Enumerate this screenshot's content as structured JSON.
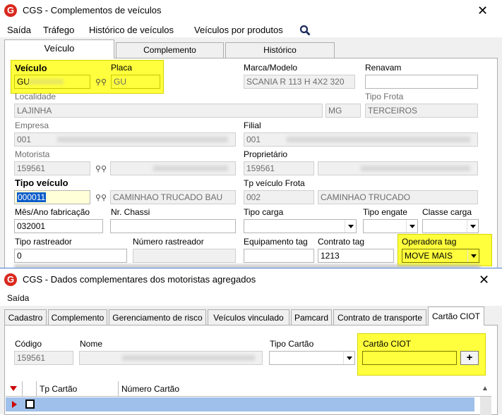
{
  "win1": {
    "title": "CGS - Complementos de veículos",
    "menu": [
      "Saída",
      "Tráfego",
      "Histórico de veículos",
      "Veículos por produtos"
    ],
    "tabs": [
      "Veículo",
      "Complemento",
      "Histórico"
    ],
    "fields": {
      "veiculo": {
        "label": "Veículo",
        "value": "GU"
      },
      "placa": {
        "label": "Placa",
        "value": "GU"
      },
      "marca": {
        "label": "Marca/Modelo",
        "value": "SCANIA R 113 H 4X2 320"
      },
      "renavam": {
        "label": "Renavam",
        "value": ""
      },
      "localidade": {
        "label": "Localidade",
        "value": "LAJINHA",
        "uf": "MG"
      },
      "tipo_frota": {
        "label": "Tipo Frota",
        "value": "TERCEIROS"
      },
      "empresa": {
        "label": "Empresa",
        "value": "001"
      },
      "filial": {
        "label": "Filial",
        "value": "001"
      },
      "motorista": {
        "label": "Motorista",
        "value": "159561"
      },
      "proprietario": {
        "label": "Proprietário",
        "value": "159561"
      },
      "tipo_veiculo": {
        "label": "Tipo veículo",
        "value": "000011",
        "desc": "CAMINHAO TRUCADO BAU"
      },
      "tp_veiculo_frota": {
        "label": "Tp veículo Frota",
        "value": "002",
        "desc": "CAMINHAO TRUCADO"
      },
      "mes_ano": {
        "label": "Mês/Ano fabricação",
        "value": "032001"
      },
      "nr_chassi": {
        "label": "Nr. Chassi",
        "value": ""
      },
      "tipo_carga": {
        "label": "Tipo carga",
        "value": ""
      },
      "tipo_engate": {
        "label": "Tipo engate",
        "value": ""
      },
      "classe_carga": {
        "label": "Classe carga",
        "value": ""
      },
      "tipo_rastreador": {
        "label": "Tipo rastreador",
        "value": "0"
      },
      "numero_rastreador": {
        "label": "Número rastreador",
        "value": ""
      },
      "equipamento_tag": {
        "label": "Equipamento tag",
        "value": ""
      },
      "contrato_tag": {
        "label": "Contrato tag",
        "value": "1213"
      },
      "operadora_tag": {
        "label": "Operadora tag",
        "value": "MOVE MAIS"
      }
    }
  },
  "win2": {
    "title": "CGS - Dados complementares dos motoristas agregados",
    "menu": [
      "Saída"
    ],
    "tabs": [
      "Cadastro",
      "Complemento",
      "Gerenciamento de risco",
      "Veículos vinculado",
      "Pamcard",
      "Contrato de transporte",
      "Cartão CIOT"
    ],
    "fields": {
      "codigo": {
        "label": "Código",
        "value": "159561"
      },
      "nome": {
        "label": "Nome",
        "value": ""
      },
      "tipo_cartao": {
        "label": "Tipo Cartão",
        "value": ""
      },
      "cartao_ciot": {
        "label": "Cartão CIOT",
        "value": ""
      }
    },
    "add_label": "+",
    "grid": {
      "columns": [
        "Tp Cartão",
        "Número Cartão"
      ]
    }
  },
  "colors": {
    "highlight": "#ffff3d",
    "selection": "#0a5cc9",
    "row": "#9fc0ea",
    "icon": "#d9281e"
  }
}
